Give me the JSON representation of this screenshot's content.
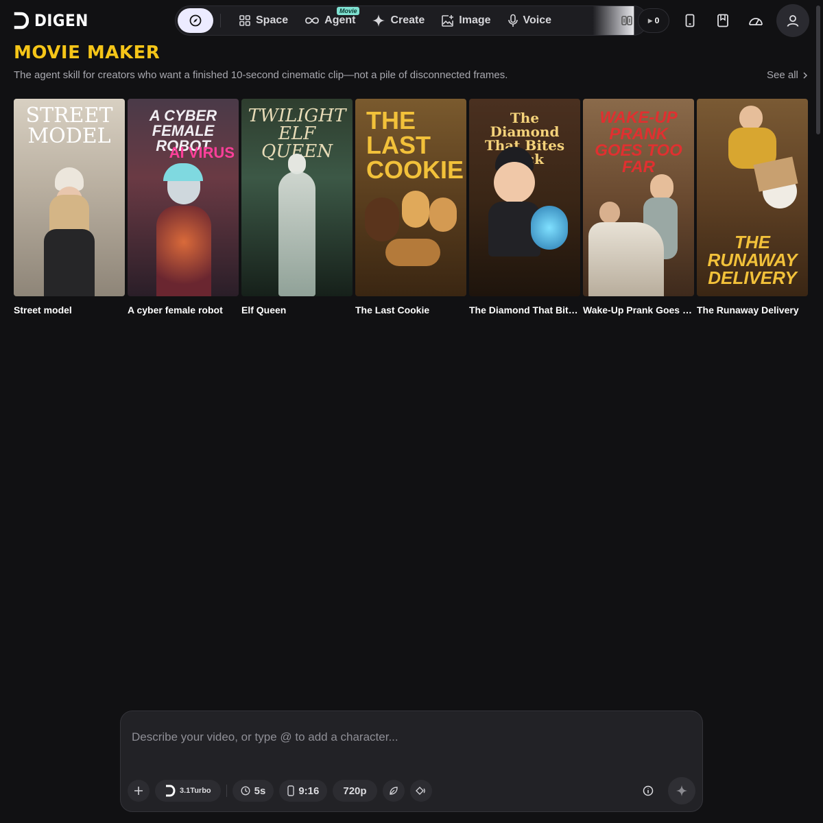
{
  "header": {
    "logo_text": "DIGEN",
    "nav": [
      {
        "label": "Space",
        "icon": "grid-icon"
      },
      {
        "label": "Agent",
        "icon": "infinity-icon",
        "badge": "Movie"
      },
      {
        "label": "Create",
        "icon": "sparkle-icon"
      },
      {
        "label": "Image",
        "icon": "image-edit-icon"
      },
      {
        "label": "Voice",
        "icon": "microphone-icon"
      }
    ],
    "credits": "0"
  },
  "section": {
    "title": "MOVIE MAKER",
    "subtitle": "The agent skill for creators who want a finished 10-second cinematic clip—not a pile of disconnected frames.",
    "see_all": "See all"
  },
  "cards": [
    {
      "label": "Street model",
      "poster_text": "STREET MODEL",
      "bg": "#c9c1b4"
    },
    {
      "label": "A cyber female robot",
      "poster_text": "A CYBER FEMALE ROBOT",
      "poster_sub": "AI VIRUS",
      "bg": "#3a2a3a"
    },
    {
      "label": "Elf Queen",
      "poster_text": "TWILIGHT ELF QUEEN",
      "bg": "#1e2c24"
    },
    {
      "label": "The Last Cookie",
      "poster_text": "THE LAST COOKIE",
      "bg": "#5a3e1e"
    },
    {
      "label": "The Diamond That Bites Back",
      "poster_text": "The Diamond That Bites Back",
      "bg": "#3a2616"
    },
    {
      "label": "Wake-Up Prank Goes Too Far",
      "poster_text": "WAKE-UP PRANK GOES TOO FAR",
      "bg": "#6a4a30"
    },
    {
      "label": "The Runaway Delivery",
      "poster_text": "THE RUNAWAY DELIVERY",
      "bg": "#5e4024"
    }
  ],
  "prompt": {
    "placeholder": "Describe your video, or type @ to add a character...",
    "model": "3.1Turbo",
    "duration": "5s",
    "ratio": "9:16",
    "resolution": "720p"
  }
}
